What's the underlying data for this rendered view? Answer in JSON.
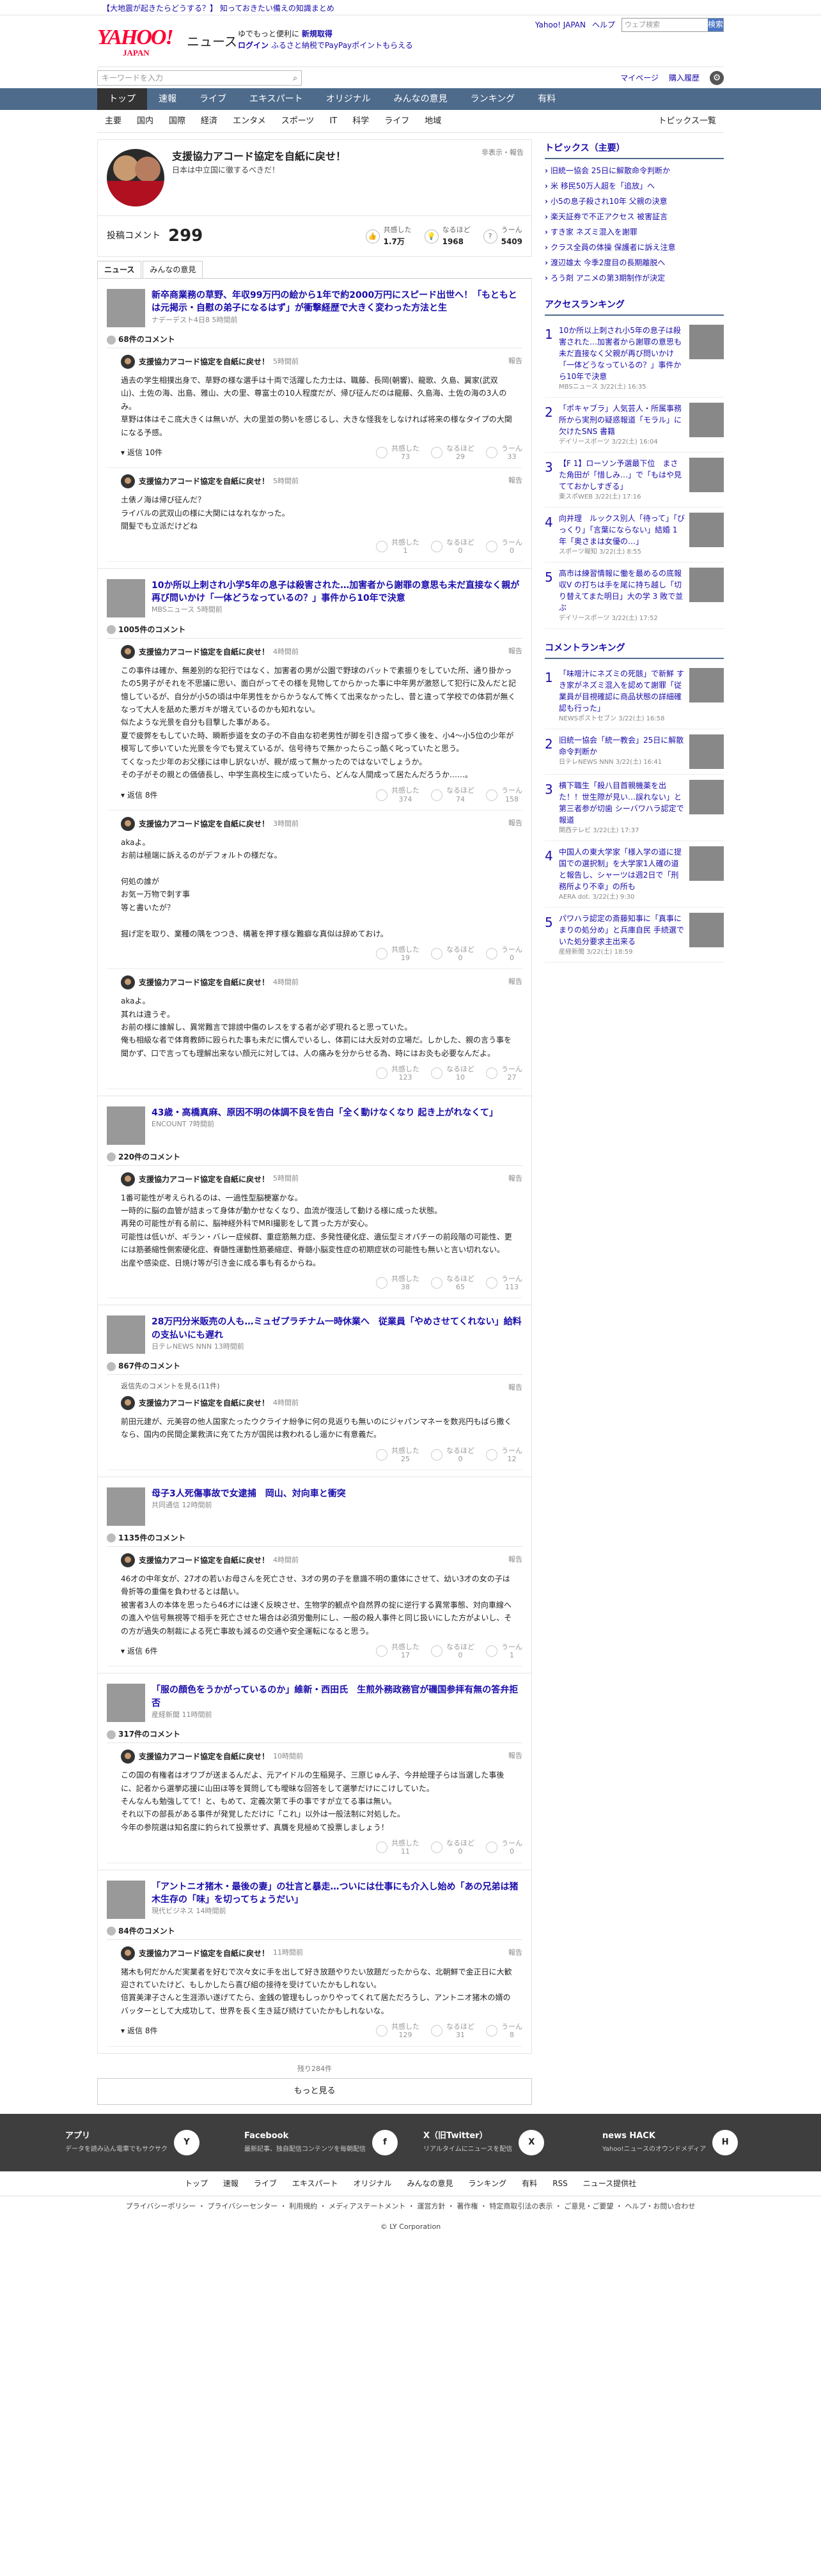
{
  "alert": {
    "prefix": "【大地震が起きたらどうする？】",
    "text": "知っておきたい備えの知識まとめ"
  },
  "header": {
    "logo": "YAHOO!",
    "logo_sub": "JAPAN",
    "news": "ニュース",
    "tag1": "ゆでもっと便利に",
    "tag1b": "新規取得",
    "tag2": "ログイン",
    "tag3": "ふるさと納税でPayPayポイントもらえる",
    "links": [
      "Yahoo! JAPAN",
      "ヘルプ"
    ],
    "search_ph": "ウェブ検索",
    "search_btn": "検索"
  },
  "sub": {
    "kw_ph": "キーワードを入力",
    "mypage": "マイページ",
    "buy": "購入履歴"
  },
  "nav": [
    "トップ",
    "速報",
    "ライブ",
    "エキスパート",
    "オリジナル",
    "みんなの意見",
    "ランキング",
    "有料"
  ],
  "cats": [
    "主要",
    "国内",
    "国際",
    "経済",
    "エンタメ",
    "スポーツ",
    "IT",
    "科学",
    "ライフ",
    "地域"
  ],
  "cats_list": "トピックス一覧",
  "article": {
    "title": "支援協力アコード協定を自紙に戻せ！",
    "subtitle": "日本は中立国に徹するべきだ！",
    "report": "非表示・報告",
    "comments_label": "投稿コメント",
    "comments": "299",
    "reacts": [
      {
        "l": "共感した",
        "v": "1.7万"
      },
      {
        "l": "なるほど",
        "v": "1968"
      },
      {
        "l": "うーん",
        "v": "5409"
      }
    ]
  },
  "tabs": [
    "ニュース",
    "みんなの意見"
  ],
  "blocks": [
    {
      "news": "新卒商業務の草野、年収99万円の絵から1年で約2000万円にスピード出世へ！「もともとは元掲示・自慰の弟子になるはず」が衝撃経歴で大きく変わった方法と生",
      "src": "ナデーデスト4日8 5時間前",
      "count": "68件のコメント",
      "comments": [
        {
          "name": "支援協力アコード協定を自紙に戻せ！",
          "time": "5時間前",
          "text": "過去の学生相撲出身で、草野の様な選手は十両で活躍した力士は、職藤、長岡(朝響)、龍歌、久島、翼家(武双山)、土佐の海、出島、雅山、大の里、尊富士の10人程度だが、帰び征んだのは龍藤、久島海、土佐の海の3人のみ。\n草野は体はそこ底大きくは無いが、大の里並の勢いを感じるし、大きな怪我をしなければ将来の様なタイプの大関になる予感。",
          "reply": "返信 10件",
          "votes": [
            "73",
            "29",
            "33"
          ]
        },
        {
          "name": "支援協力アコード協定を自紙に戻せ！",
          "time": "5時間前",
          "text": "土俵ノ海は帰び征んだ？\nライバルの武双山の様に大関にはなれなかった。\n間髪でも立派だけどね",
          "reply": "",
          "votes": [
            "1",
            "0",
            "0"
          ]
        }
      ]
    },
    {
      "news": "10か所以上刺され小学5年の息子は殺害された…加害者から謝罪の意思も未だ直接なく親が再び問いかけ「一体どうなっているの？」事件から10年で決意",
      "src": "MBSニュース 5時間前",
      "count": "1005件のコメント",
      "comments": [
        {
          "name": "支援協力アコード協定を自紙に戻せ！",
          "time": "4時間前",
          "text": "この事件は確か、無差別的な犯行ではなく、加害者の男が公園で野球のバットで素振りをしていた所、通り掛かったの5男子がそれを不思議に思い、面白がってその様を見物してからかった事に中年男が激怒して犯行に及んだと記憶しているが、自分が小5の頃は中年男性をからかうなんて怖くて出来なかったし、昔と違って学校での体罰が無くなって大人を舐めた悪ガキが増えているのかも知れない。\n似たような光景を自分も目撃した事がある。\n夏で疲弊をもしていた時、瞬断歩道を女の子の不自由な初老男性が脚を引き摺って歩く後を、小4〜小5位の少年が模写して歩いていた光景を今でも覚えているが、信号待ちで無かったらこっ酷く叱っていたと思う。\nてくなった少年のお父様には申し訳ないが、親が成って無かったのではないでしょうか。\nその子がその親との価値長し、中学生高校生に成っていたら、どんな人間成って居たんだろうか……。",
          "reply": "返信 8件",
          "votes": [
            "374",
            "74",
            "158"
          ]
        },
        {
          "name": "支援協力アコード協定を自紙に戻せ！",
          "time": "3時間前",
          "text": "akaよ。\nお前は極端に訴えるのがデフォルトの様だな。\n\n何処の誰が\nお気ー万物で刺す事\n等と書いたが？\n\n掘げ定を取り、業種の隅をつつき、構著を押す様な難癖な真似は辞めておけ。",
          "reply": "",
          "votes": [
            "19",
            "0",
            "0"
          ]
        },
        {
          "name": "支援協力アコード協定を自紙に戻せ！",
          "time": "4時間前",
          "text": "akaよ。\n其れは違うぞ。\nお前の様に誰解し、異常難言で誹謗中傷のレスをする者が必ず現れると思っていた。\n俺も相級な者で体育教師に殴られた事も未だに慣んでいるし、体罰には大反対の立場だ。しかした、親の言う事を聞かず、口で言っても理解出来ない顔元に対しては、人の痛みを分からせる為、時にはお灸も必要なんだよ。",
          "reply": "",
          "votes": [
            "123",
            "10",
            "27"
          ]
        }
      ]
    },
    {
      "news": "43歳・高橋真麻、原因不明の体調不良を告白「全く動けなくなり 起き上がれなくて」",
      "src": "ENCOUNT 7時間前",
      "count": "220件のコメント",
      "comments": [
        {
          "name": "支援協力アコード協定を自紙に戻せ！",
          "time": "5時間前",
          "text": "1番可能性が考えられるのは、一過性型脳梗塞かな。\n一時的に脳の血管が詰まって身体が動かせなくなり、血流が復活して動ける様に成った状態。\n再発の可能性が有る前に、脳神経外科でMRI撮影をして貰った方が安心。\n可能性は低いが、ギラン・バレー症候群、重症筋無力症、多発性硬化症、遺伝型ミオパチーの前段階の可能性、更には筋萎縮性側索硬化症、脊髄性運動性筋萎縮症、脊髄小脳変性症の初期症状の可能性も無いと言い切れない。\n出産や感染症、日焼け等が引き金に成る事も有るからね。",
          "reply": "",
          "votes": [
            "38",
            "65",
            "113"
          ]
        }
      ]
    },
    {
      "news": "28万円分米販売の人も…ミュゼプラチナム一時休業へ　従業員「やめさせてくれない」給料の支払いにも遅れ",
      "src": "日テレNEWS NNN 13時間前",
      "count": "867件のコメント",
      "comments": [
        {
          "name": "支援協力アコード協定を自紙に戻せ！",
          "time": "4時間前",
          "text": "前田元建が、元美容の他人国家たったウクライナ紛争に何の見返りも無いのにジャパンマネーを数兆円もばら撒くなら、国内の民間企業救済に充てた方が国民は救われるし遥かに有意義だ。",
          "reply": "",
          "votes": [
            "25",
            "0",
            "12"
          ],
          "pre": "返信先のコメントを見る(11件)"
        }
      ]
    },
    {
      "news": "母子3人死傷事故で女逮捕　岡山、対向車と衝突",
      "src": "共同通信 12時間前",
      "count": "1135件のコメント",
      "comments": [
        {
          "name": "支援協力アコード協定を自紙に戻せ！",
          "time": "4時間前",
          "text": "46才の中年女が、27才の若いお母さんを死亡させ、3才の男の子を意識不明の重体にさせて、幼い3才の女の子は骨折等の重傷を負わせるとは酷い。\n被害者3人の本体を思ったら46才には速く反映させ、生物学的観点や自然界の掟に逆行する異常事態、対向車線への進入や信号無視等で相手を死亡させた場合は必須労働刑にし、一般の殺人事件と同じ扱いにした方がよいし、その方が過失の制裁による死亡事故も減るの交通や安全運転になると思う。",
          "reply": "返信 6件",
          "votes": [
            "17",
            "0",
            "1"
          ]
        }
      ]
    },
    {
      "news": "「服の顔色をうかがっているのか」維新・西田氏　生煎外務政務官が磯国参拝有無の答弁拒否",
      "src": "産経新聞 11時間前",
      "count": "317件のコメント",
      "comments": [
        {
          "name": "支援協力アコード協定を自紙に戻せ！",
          "time": "10時間前",
          "text": "この国の有権者はオワブが送まるんだよ、元アイドルの生稲晃子、三原じゅん子、今井絵理子らは当選した事後に、記者から選挙応援に山田ほ等を質問しても曖昧な回答をして選挙だけにこけしていた。\nそんなんも勉強してて！と、もめて、定義次第て手の事ですが立てる事は無い。\nそれ以下の部長がある事件が発覚しただけに「これ」以外は一般法制に対処した。\n今年の参院選は知名度に釣られて投票せず、真贋を見極めて投票しましょう！",
          "reply": "",
          "votes": [
            "11",
            "0",
            "0"
          ]
        }
      ]
    },
    {
      "news": "「アントニオ猪木・最後の妻」の壮言と暴走…ついには仕事にも介入し始め「あの兄弟は猪木生存の「味」を切ってちょうだい」",
      "src": "現代ビジネス 14時間前",
      "count": "84件のコメント",
      "comments": [
        {
          "name": "支援協力アコード協定を自紙に戻せ！",
          "time": "11時間前",
          "text": "猪木も何だかんだ実業者を好むで次々女に手を出して好き放題やりたい放題だったからな、北朝鮮で金正日に大歓迎されていたけど、もしかしたら喜び組の接待を受けていたかもしれない。\n倍賞美津子さんと生涯添い遂げてたら、金銭の管理もしっかりやってくれて居ただろうし、アントニオ猪木の婿のバッターとして大成功して、世界を長く生き延び続けていたかもしれないな。",
          "reply": "返信 8件",
          "votes": [
            "129",
            "31",
            "8"
          ]
        }
      ]
    }
  ],
  "rest": "残り284件",
  "more": "もっと見る",
  "side": {
    "topics_title": "トピックス（主要）",
    "topics": [
      "旧統一協会 25日に解散命令判断か",
      "米 移民50万人超を「追放」へ",
      "小5の息子殺され10年 父親の決意",
      "楽天証券で不正アクセス 被害証言",
      "すき家 ネズミ混入を謝罪",
      "クラス全員の体操 保護者に訴え注意",
      "渡辺雄太 今季2度目の長期離脱へ",
      "ろう剤 アニメの第3期制作が決定"
    ],
    "access_title": "アクセスランキング",
    "access": [
      {
        "t": "10か所以上刺され小5年の息子は殺害された…加害者から謝罪の意思も未だ直接なく父親が再び問いかけ「一体どうなっているの？」事件から10年で決意",
        "s": "MBSニュース 3/22(土) 16:35"
      },
      {
        "t": "「ポキャブラ」人気芸人・所属事務所から実刑の疑惑報道「モラル」に欠けたSNS 書籍",
        "s": "デイリースポーツ 3/22(土) 16:04"
      },
      {
        "t": "【F 1】ローソン予選最下位　まさた角田が「惜しみ…」で「もはや見てておかしすぎる」",
        "s": "東スポWEB 3/22(土) 17:16"
      },
      {
        "t": "向井理　ルックス別人「待って」「びっくり」「言葉にならない」結婚 1 年「奥さまは女優の…」",
        "s": "スポーツ報知 3/22(土) 8:55"
      },
      {
        "t": "高市は練習情報に働を最めるの底報収V の打ちは手を尾に持ち越し「切り替えてまた明日」大の学 3 敗で並ぶ",
        "s": "デイリースポーツ 3/22(土) 17:52"
      }
    ],
    "comment_title": "コメントランキング",
    "comrank": [
      {
        "t": "「味噌汁にネズミの死骸」で新鮮 すき家がネズミ混入を認めて謝罪「従業員が目視確認に商品状態の詳細確認も行った」",
        "s": "NEWSポストセブン 3/22(土) 16:58"
      },
      {
        "t": "旧統一協会「統一教会」25日に解散命令判断か",
        "s": "日テレNEWS NNN 3/22(土) 16:41"
      },
      {
        "t": "横下職生「殺八目首親機薬を出た！！世生際が見い…誤れない」と第三者参が切歯 シーバワハラ認定で報道",
        "s": "関西テレビ 3/22(土) 17:37"
      },
      {
        "t": "中国人の東大学家「様入学の道に提国での選択制」を大学家1人確の道と報告し、シャーツは週2日で「刑務所より不幸」の所も",
        "s": "AERA dot. 3/22(土) 9:30"
      },
      {
        "t": "パワハラ認定の斎藤知事に「真事にまりの処分め」と兵庫自民 手続選でいた処分要求主出来る",
        "s": "産経新聞 3/22(土) 18:59"
      }
    ]
  },
  "footer": {
    "boxes": [
      {
        "h": "アプリ",
        "s": "データを読み込ん電車でもサクサク",
        "i": "Y"
      },
      {
        "h": "Facebook",
        "s": "最新記事、独自配信コンテンツを毎朝配信",
        "i": "f"
      },
      {
        "h": "X（旧Twitter）",
        "s": "リアルタイムにニュースを配信",
        "i": "X"
      },
      {
        "h": "news HACK",
        "s": "Yahoo!ニュースのオウンドメディア",
        "i": "H"
      }
    ],
    "nav": [
      "トップ",
      "速報",
      "ライブ",
      "エキスパート",
      "オリジナル",
      "みんなの意見",
      "ランキング",
      "有料",
      "RSS",
      "ニュース提供社"
    ],
    "small": "プライバシーポリシー ・ プライバシーセンター ・ 利用規約 ・ メディアステートメント ・ 運営方針 ・ 著作権 ・ 特定商取引法の表示 ・ ご意見・ご要望 ・ ヘルプ・お問い合わせ",
    "copy": "© LY Corporation"
  }
}
